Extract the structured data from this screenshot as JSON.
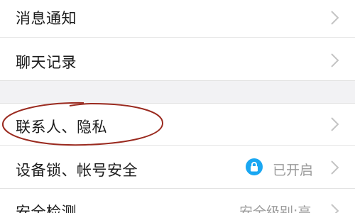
{
  "settings": {
    "items": [
      {
        "label": "消息通知"
      },
      {
        "label": "聊天记录"
      },
      {
        "label": "联系人、隐私"
      },
      {
        "label": "设备锁、帐号安全",
        "status": "已开启",
        "status_icon": "lock-icon"
      },
      {
        "label": "安全检测",
        "status": "安全级别:高"
      }
    ]
  },
  "colors": {
    "accent": "#1aa7f2",
    "annotation": "#9a2a1f",
    "section_gap": "#f2f2f4",
    "divider": "#e3e3e3"
  }
}
